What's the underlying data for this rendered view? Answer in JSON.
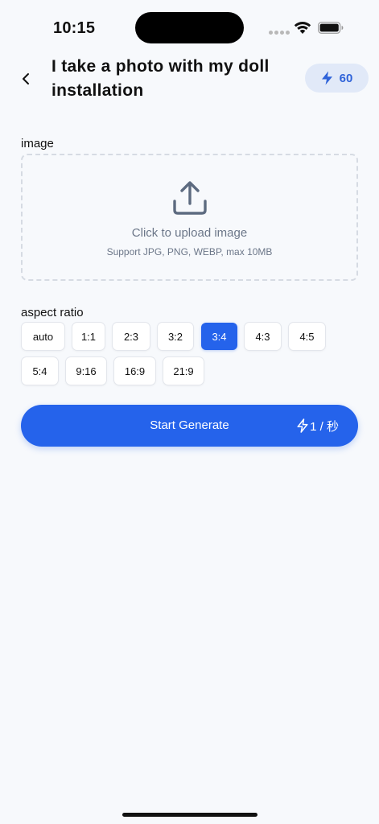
{
  "status": {
    "time": "10:15"
  },
  "header": {
    "title": "I take a photo with my doll installation",
    "credits": "60"
  },
  "image_section": {
    "label": "image",
    "upload_text": "Click to upload image",
    "upload_hint": "Support JPG, PNG, WEBP, max 10MB"
  },
  "ratio_section": {
    "label": "aspect ratio",
    "options": [
      "auto",
      "1:1",
      "2:3",
      "3:2",
      "3:4",
      "4:3",
      "4:5",
      "5:4",
      "9:16",
      "16:9",
      "21:9"
    ],
    "selected": "3:4"
  },
  "generate": {
    "label": "Start Generate",
    "cost": "1 / 秒"
  },
  "colors": {
    "accent": "#2563eb",
    "background": "#f7f9fc",
    "credits_bg": "#e1e9f8"
  }
}
